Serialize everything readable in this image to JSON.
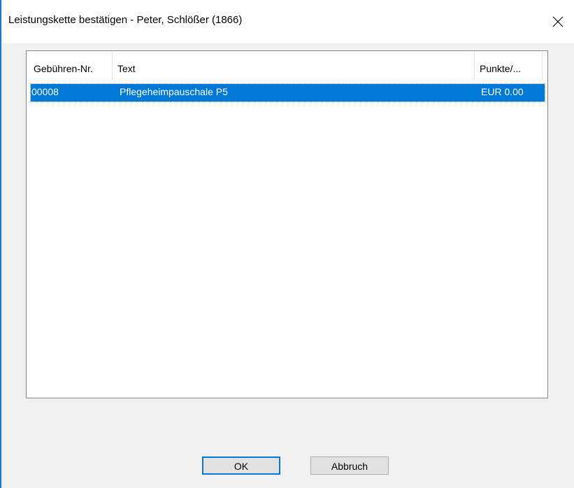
{
  "window": {
    "title": "Leistungskette bestätigen - Peter, Schlößer (1866)",
    "close_icon": "close-icon"
  },
  "listview": {
    "columns": [
      {
        "label": "Gebühren-Nr."
      },
      {
        "label": "Text"
      },
      {
        "label": "Punkte/..."
      }
    ],
    "rows": [
      {
        "gebuehren_nr": "00008",
        "text": "Pflegeheimpauschale P5",
        "punkte": "EUR 0.00",
        "selected": true
      }
    ]
  },
  "buttons": {
    "ok_label": "OK",
    "cancel_label": "Abbruch"
  },
  "colors": {
    "accent": "#0078d7",
    "window_border": "#1979ca",
    "selection_text": "#ffffff"
  }
}
